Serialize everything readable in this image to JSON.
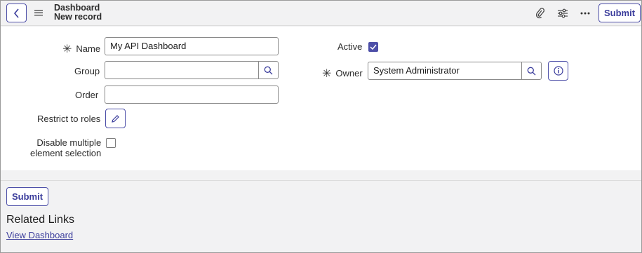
{
  "header": {
    "back_icon": "chevron-left-icon",
    "menu_icon": "hamburger-menu-icon",
    "title_line1": "Dashboard",
    "title_line2": "New record",
    "attach_icon": "paperclip-icon",
    "settings_icon": "sliders-icon",
    "more_icon": "more-options-icon",
    "submit_label": "Submit"
  },
  "form": {
    "required_marker": "✳",
    "name": {
      "label": "Name",
      "value": "My API Dashboard",
      "required": true
    },
    "group": {
      "label": "Group",
      "value": ""
    },
    "order": {
      "label": "Order",
      "value": ""
    },
    "restrict_to_roles": {
      "label": "Restrict to roles"
    },
    "disable_multiple": {
      "label_line1": "Disable multiple",
      "label_line2": "element selection",
      "checked": false
    },
    "active": {
      "label": "Active",
      "checked": true
    },
    "owner": {
      "label": "Owner",
      "value": "System Administrator",
      "required": true
    }
  },
  "footer": {
    "submit_label": "Submit",
    "related_links_title": "Related Links",
    "view_dashboard_label": "View Dashboard"
  },
  "colors": {
    "accent": "#4d4fa8",
    "header_bg": "#f2f2f3",
    "link": "#3b3d9c"
  }
}
